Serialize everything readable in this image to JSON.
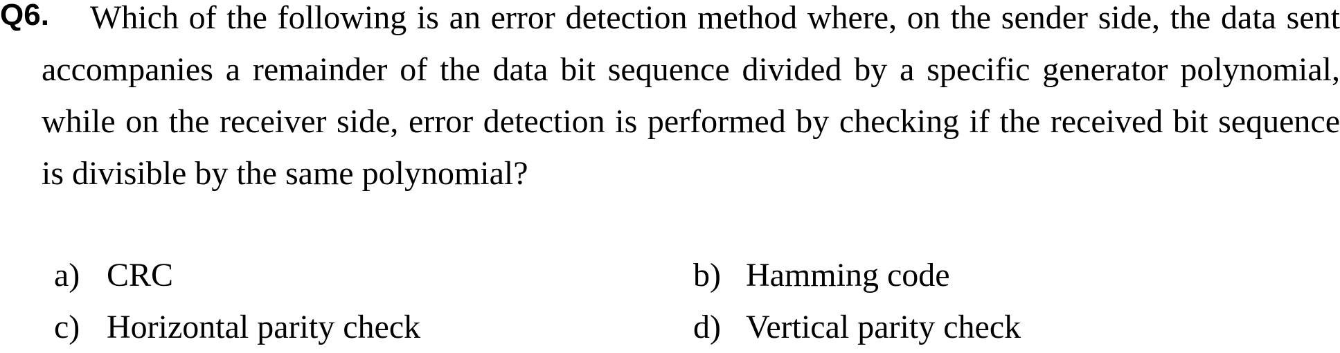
{
  "question": {
    "number": "Q6.",
    "text": "Which of the following is an error detection method where, on the sender side, the data sent accompanies a remainder of the data bit sequence divided by a specific generator polynomial, while on the receiver side, error detection is performed by checking if the received bit sequence is divisible by the same polynomial?"
  },
  "options": [
    {
      "letter": "a)",
      "text": "CRC"
    },
    {
      "letter": "b)",
      "text": "Hamming code"
    },
    {
      "letter": "c)",
      "text": "Horizontal parity check"
    },
    {
      "letter": "d)",
      "text": "Vertical parity check"
    }
  ]
}
